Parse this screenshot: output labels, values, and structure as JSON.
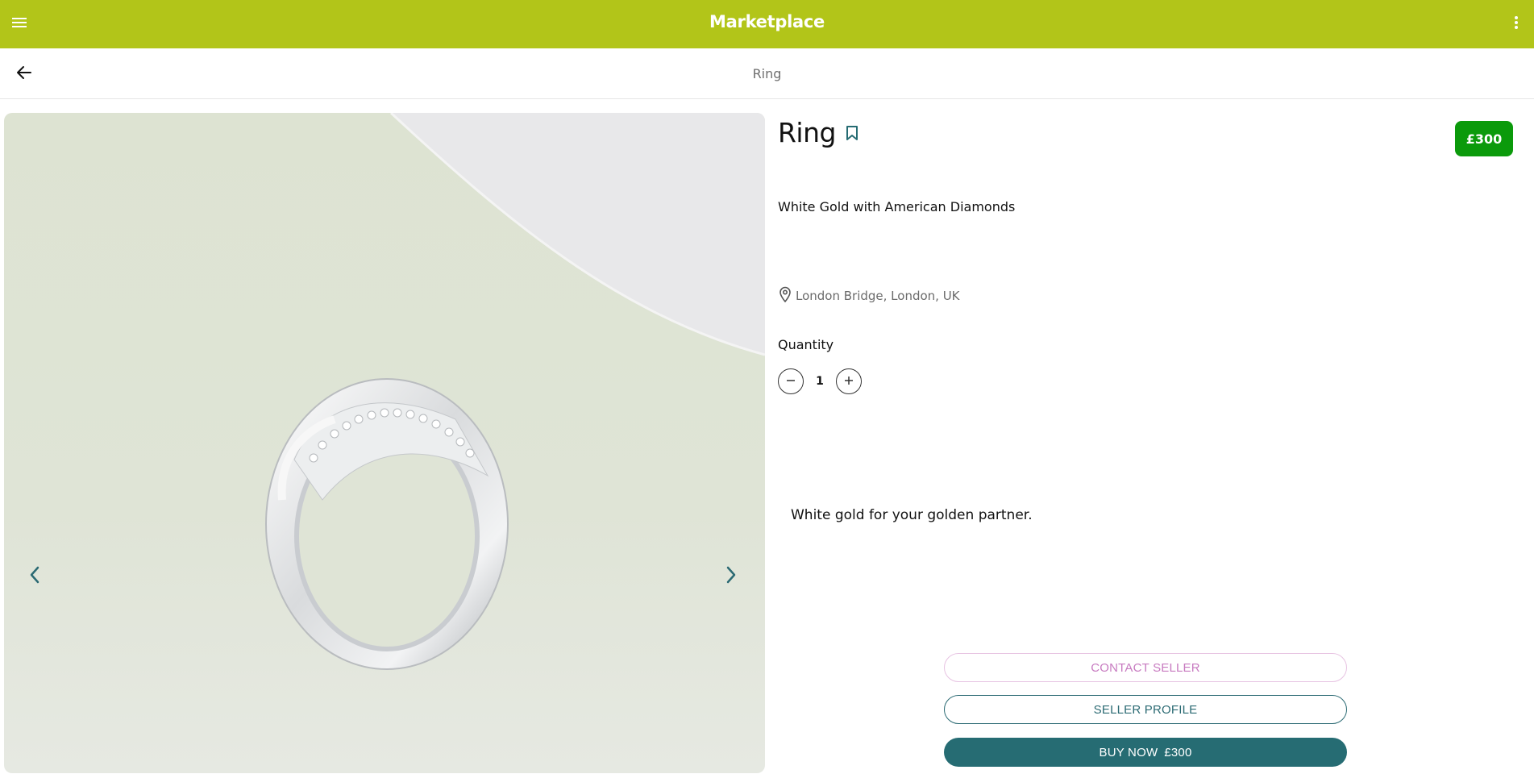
{
  "app": {
    "title": "Marketplace"
  },
  "header": {
    "breadcrumb": "Ring"
  },
  "product": {
    "title": "Ring",
    "price": "£300",
    "subtitle": "White Gold with American Diamonds",
    "location": "London Bridge, London, UK",
    "quantity_label": "Quantity",
    "quantity": "1",
    "description": "White gold for your golden partner."
  },
  "actions": {
    "contact_label": "CONTACT SELLER",
    "profile_label": "SELLER PROFILE",
    "buy_label": "BUY NOW",
    "buy_price": "£300"
  },
  "icons": {
    "menu": "menu-icon",
    "more": "more-vert-icon",
    "back": "arrow-left-icon",
    "bookmark": "bookmark-icon",
    "location": "location-pin-icon",
    "prev": "chevron-left-icon",
    "next": "chevron-right-icon",
    "minus": "minus-icon",
    "plus": "plus-icon"
  },
  "colors": {
    "brand_bar": "#b2c519",
    "price_badge": "#0b9a0b",
    "primary_button": "#266c73",
    "contact_accent": "#c77ac0",
    "nav_chevron": "#2b6a73"
  }
}
